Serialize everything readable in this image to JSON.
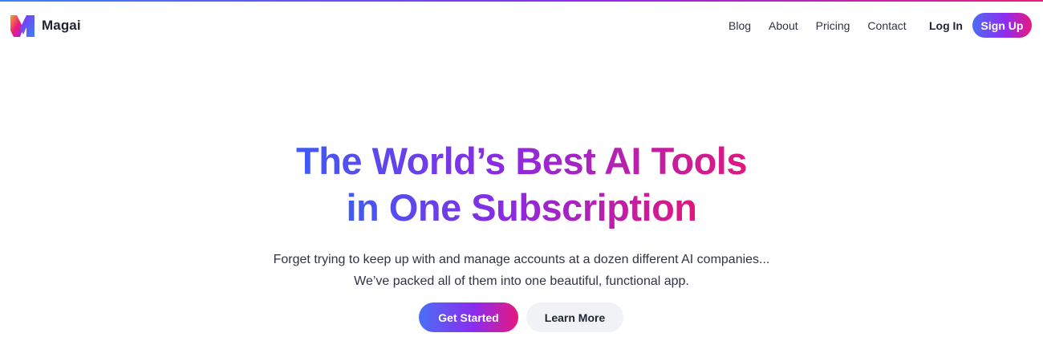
{
  "brand": {
    "name": "Magai",
    "logo_icon": "magai-m-logo-icon",
    "gradient": [
      "#3b82f6",
      "#8b2cf5",
      "#ec1c7c"
    ]
  },
  "nav": {
    "links": [
      "Blog",
      "About",
      "Pricing",
      "Contact"
    ],
    "login_label": "Log In",
    "signup_label": "Sign Up"
  },
  "hero": {
    "headline_line1": "The World’s Best AI Tools",
    "headline_line2": "in One Subscription",
    "sub_line1": "Forget trying to keep up with and manage accounts at a dozen different AI companies...",
    "sub_line2": "We’ve packed all of them into one beautiful, functional app.",
    "primary_cta": "Get Started",
    "secondary_cta": "Learn More"
  }
}
